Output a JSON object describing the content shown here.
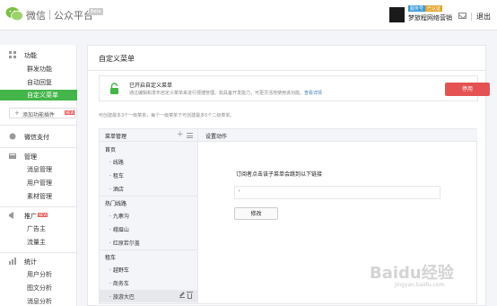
{
  "header": {
    "brand_logo": "wechat-logo-icon",
    "brand_name": "微信",
    "platform_name": "公众平台",
    "beta_tag": "Beta",
    "account_name": "梦旅程网络营销",
    "badge_left": "服务号",
    "badge_right": "已认证",
    "logout_label": "退出",
    "mail_icon": "mail-icon"
  },
  "sidebar": {
    "sections": [
      {
        "title": "功能",
        "icon": "function-icon",
        "items": [
          "群发功能",
          "自动回复",
          "自定义菜单"
        ]
      },
      {
        "title": "微信支付",
        "icon": "pay-icon",
        "items": []
      },
      {
        "title": "管理",
        "icon": "manage-icon",
        "items": [
          "消息管理",
          "用户管理",
          "素材管理"
        ]
      },
      {
        "title": "推广",
        "icon": "promote-icon",
        "new": "NEW",
        "items": [
          "广告主",
          "流量主"
        ]
      },
      {
        "title": "统计",
        "icon": "stats-icon",
        "items": [
          "用户分析",
          "图文分析",
          "消息分析"
        ]
      }
    ],
    "active_item": "自定义菜单",
    "add_plugin_label": "添加功能插件",
    "add_plugin_tag": "NEW"
  },
  "main": {
    "title": "自定义菜单",
    "notice": {
      "title": "已开启自定义菜单",
      "desc": "通过编辑和发布自定义菜单来进行便捷管理，如具备开发能力，可更灵活地使用该功能。",
      "link": "查看详情",
      "button": "停用"
    },
    "hint": "可创建最多3个一级菜单，每个一级菜单下可创建最多5个二级菜单。",
    "menu_manager": {
      "title": "菜单管理",
      "groups": [
        {
          "label": "首页",
          "children": [
            "线路",
            "租车",
            "酒店"
          ]
        },
        {
          "label": "热门线路",
          "children": [
            "九寨沟",
            "峨眉山",
            "红原若尔盖"
          ]
        },
        {
          "label": "租车",
          "children": [
            "越野车",
            "商务车",
            "旅游大巴"
          ]
        }
      ],
      "selected": "旅游大巴"
    },
    "action": {
      "title": "设置动作",
      "label": "订阅者点击该子菜单会跳到以下链接",
      "url_value": "'",
      "modify_button": "修改"
    }
  },
  "watermark": {
    "text": "Baidu经验",
    "url": "jingyan.baidu.com"
  },
  "colors": {
    "accent_green": "#44b549",
    "danger_red": "#e55252",
    "link_blue": "#4a7fb8"
  }
}
